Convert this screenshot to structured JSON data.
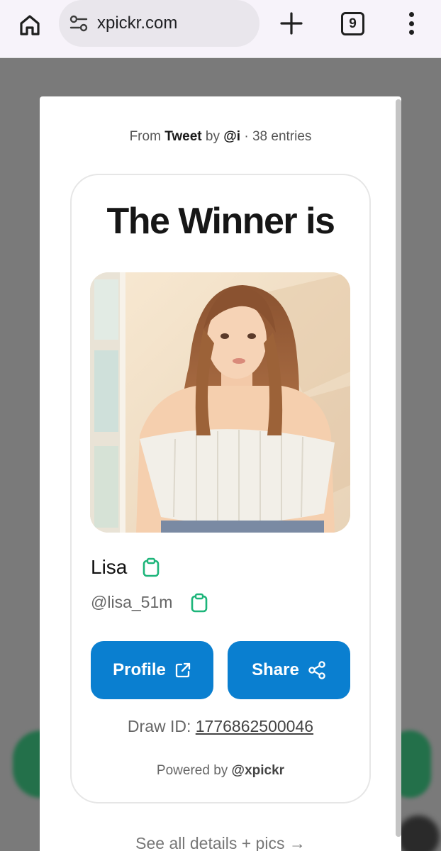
{
  "browser": {
    "url": "xpickr.com",
    "tab_count": "9"
  },
  "modal": {
    "source_prefix": "From",
    "source_name": "Tweet",
    "source_by": "by",
    "source_user": "@i",
    "source_entries": "· 38 entries",
    "title": "The Winner is",
    "winner_name": "Lisa",
    "winner_handle": "@lisa_51m",
    "profile_label": "Profile",
    "share_label": "Share",
    "draw_id_label": "Draw ID:",
    "draw_id_value": "1776862500046",
    "powered_prefix": "Powered by",
    "powered_brand": "@xpickr",
    "see_all": "See all details + pics →"
  },
  "colors": {
    "accent_button": "#0a7fd0",
    "copy_icon": "#1db57a"
  }
}
